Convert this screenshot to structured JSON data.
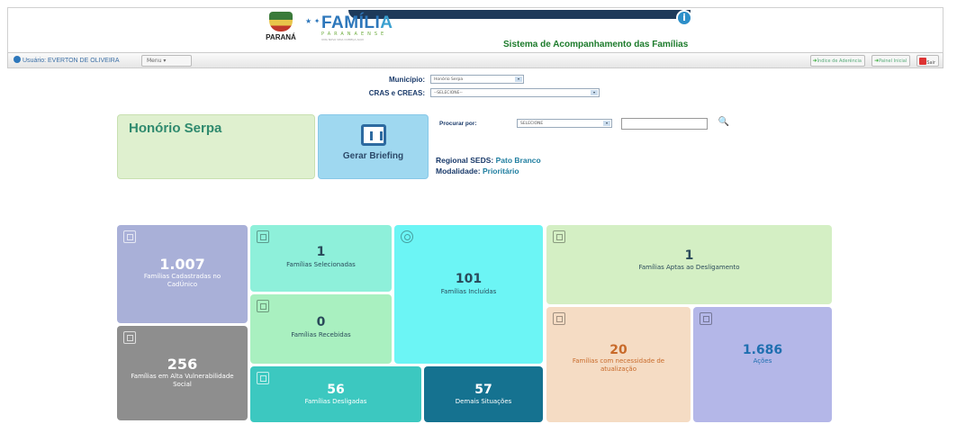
{
  "header": {
    "logo_parana": "PARANÁ",
    "logo_familia_main": "FAMÍLI",
    "logo_familia_last": "A",
    "logo_familia_sub": "PARANAENSE",
    "logo_slogan": "UMA NOVA VIDA COMEÇA AQUI",
    "system_title": "Sistema de Acompanhamento das Famílias"
  },
  "userbar": {
    "user_label": "Usuário: EVERTON DE OLIVEIRA",
    "menu_label": "Menu ▾",
    "btn_adherence": "Índice de Aderência",
    "btn_home": "Painel Inicial",
    "btn_exit": "Sair"
  },
  "filters": {
    "municipio_label": "Município:",
    "municipio_value": "Honório Serpa",
    "cras_label": "CRAS e CREAS:",
    "cras_value": "--SELECIONE--",
    "search_label": "Procurar por:",
    "search_select_value": "SELECIONE",
    "search_value": ""
  },
  "city": {
    "name": "Honório Serpa",
    "briefing_label": "Gerar Briefing",
    "regional_label": "Regional SEDS:",
    "regional_value": "Pato Branco",
    "modalidade_label": "Modalidade:",
    "modalidade_value": "Prioritário"
  },
  "tiles": {
    "cadastradas": {
      "value": "1.007",
      "label_1": "Famílias Cadastradas no",
      "label_2": "CadÚnico",
      "color": "#a9b0d8"
    },
    "vulnerab": {
      "value": "256",
      "label_1": "Famílias em Alta Vulnerabilidade",
      "label_2": "Social",
      "color": "#8e8e8e"
    },
    "selecionadas": {
      "value": "1",
      "label": "Famílias Selecionadas",
      "color": "#8ef0da"
    },
    "recebidas": {
      "value": "0",
      "label": "Famílias Recebidas",
      "color": "#a9f0c0"
    },
    "incluidas": {
      "value": "101",
      "label": "Famílias Incluídas",
      "color": "#6cf5f5"
    },
    "desligadas": {
      "value": "56",
      "label": "Famílias Desligadas",
      "color": "#3cc8c0"
    },
    "demais": {
      "value": "57",
      "label": "Demais Situações",
      "color": "#157290"
    },
    "aptas": {
      "value": "1",
      "label": "Famílias Aptas ao Desligamento",
      "color": "#d4efc4"
    },
    "atualizacao": {
      "value": "20",
      "label_1": "Famílias com necessidade de",
      "label_2": "atualização",
      "color": "#f5dcc4"
    },
    "acoes": {
      "value": "1.686",
      "label": "Ações",
      "color": "#b4b7e8"
    }
  }
}
